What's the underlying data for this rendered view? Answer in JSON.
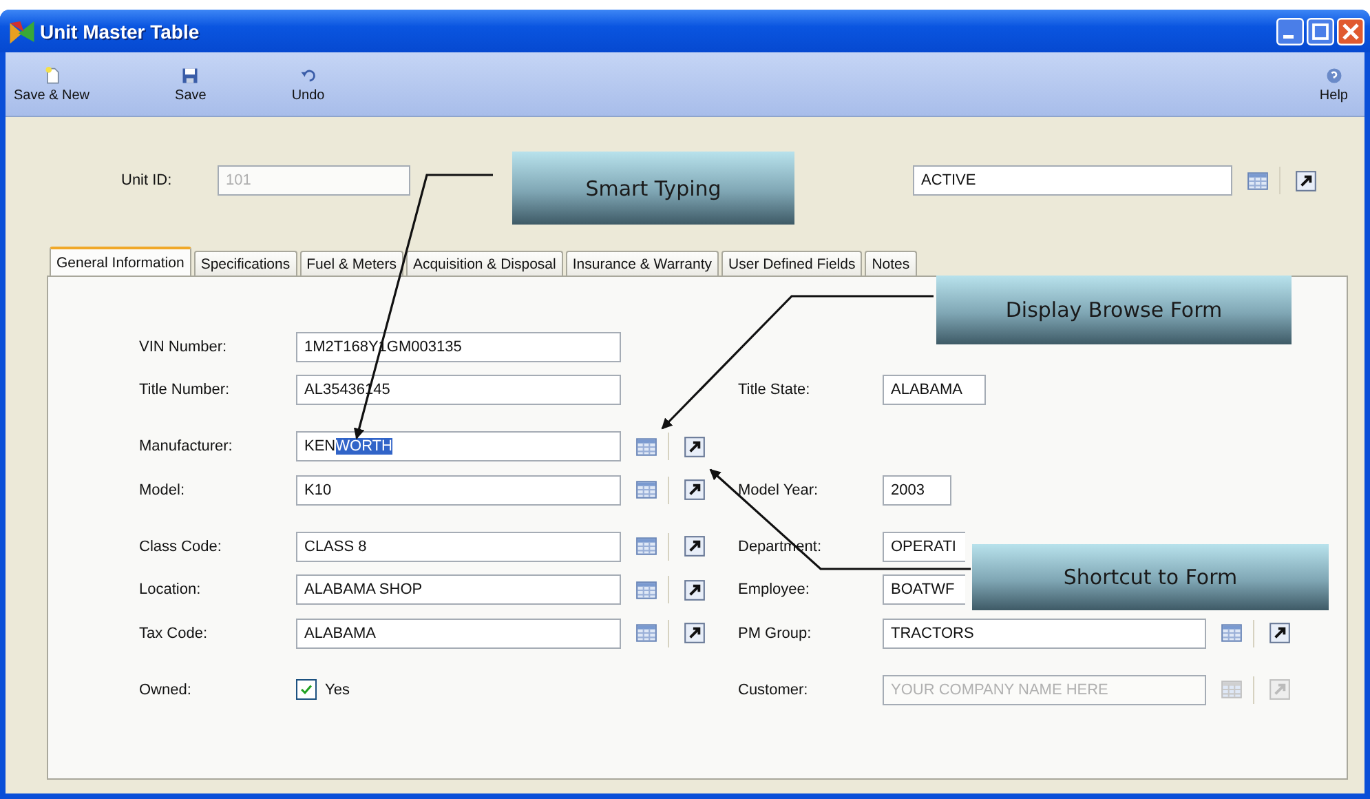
{
  "window": {
    "title": "Unit Master Table"
  },
  "toolbar": [
    {
      "label": "Save & New",
      "kind": "new"
    },
    {
      "label": "Save",
      "kind": "save"
    },
    {
      "label": "Undo",
      "kind": "undo"
    }
  ],
  "toolbar_right": [
    {
      "label": "Help",
      "kind": "help"
    }
  ],
  "header": {
    "unit_id": {
      "label": "Unit ID:",
      "value": "101",
      "disabled": true
    },
    "status": {
      "value": "ACTIVE",
      "disabled": false
    }
  },
  "tabs": [
    {
      "label": "General Information",
      "selected": true
    },
    {
      "label": "Specifications",
      "selected": false
    },
    {
      "label": "Fuel & Meters",
      "selected": false
    },
    {
      "label": "Acquisition & Disposal",
      "selected": false
    },
    {
      "label": "Insurance & Warranty",
      "selected": false
    },
    {
      "label": "User Defined Fields",
      "selected": false
    },
    {
      "label": "Notes",
      "selected": false
    }
  ],
  "groups": [
    [
      {
        "left": {
          "kind": "text",
          "label": "VIN Number:",
          "value": "1M2T168Y1GM003135",
          "disabled": false
        }
      },
      {
        "left": {
          "kind": "text",
          "label": "Title Number:",
          "value": "AL35436145",
          "disabled": false
        },
        "right": {
          "kind": "short",
          "label": "Title State:",
          "value": "ALABAMA",
          "disabled": false
        }
      }
    ],
    [
      {
        "left": {
          "kind": "lookup",
          "label": "Manufacturer:",
          "typed": "KEN",
          "suggested": "WORTH",
          "disabled": false
        }
      },
      {
        "left": {
          "kind": "lookup",
          "label": "Model:",
          "value": "K10",
          "disabled": false
        },
        "right": {
          "kind": "short",
          "label": "Model Year:",
          "value": "2003",
          "disabled": false
        }
      }
    ],
    [
      {
        "left": {
          "kind": "lookup",
          "label": "Class Code:",
          "value": "CLASS 8",
          "disabled": false
        },
        "right": {
          "kind": "partial",
          "label": "Department:",
          "value": "OPERATI",
          "disabled": false
        }
      },
      {
        "left": {
          "kind": "lookup",
          "label": "Location:",
          "value": "ALABAMA SHOP",
          "disabled": false
        },
        "right": {
          "kind": "partial",
          "label": "Employee:",
          "value": "BOATWF",
          "disabled": false
        }
      },
      {
        "left": {
          "kind": "lookup",
          "label": "Tax Code:",
          "value": "ALABAMA",
          "disabled": false
        },
        "right": {
          "kind": "lookup",
          "label": "PM Group:",
          "value": "TRACTORS",
          "disabled": false
        }
      }
    ],
    [
      {
        "left": {
          "kind": "checkbox",
          "label": "Owned:",
          "text": "Yes",
          "checked": true
        },
        "right": {
          "kind": "lookup",
          "label": "Customer:",
          "value": "YOUR COMPANY NAME HERE",
          "disabled": true
        }
      }
    ]
  ],
  "callouts": [
    {
      "text": "Smart Typing"
    },
    {
      "text": "Display Browse Form"
    },
    {
      "text": "Shortcut to Form"
    }
  ]
}
